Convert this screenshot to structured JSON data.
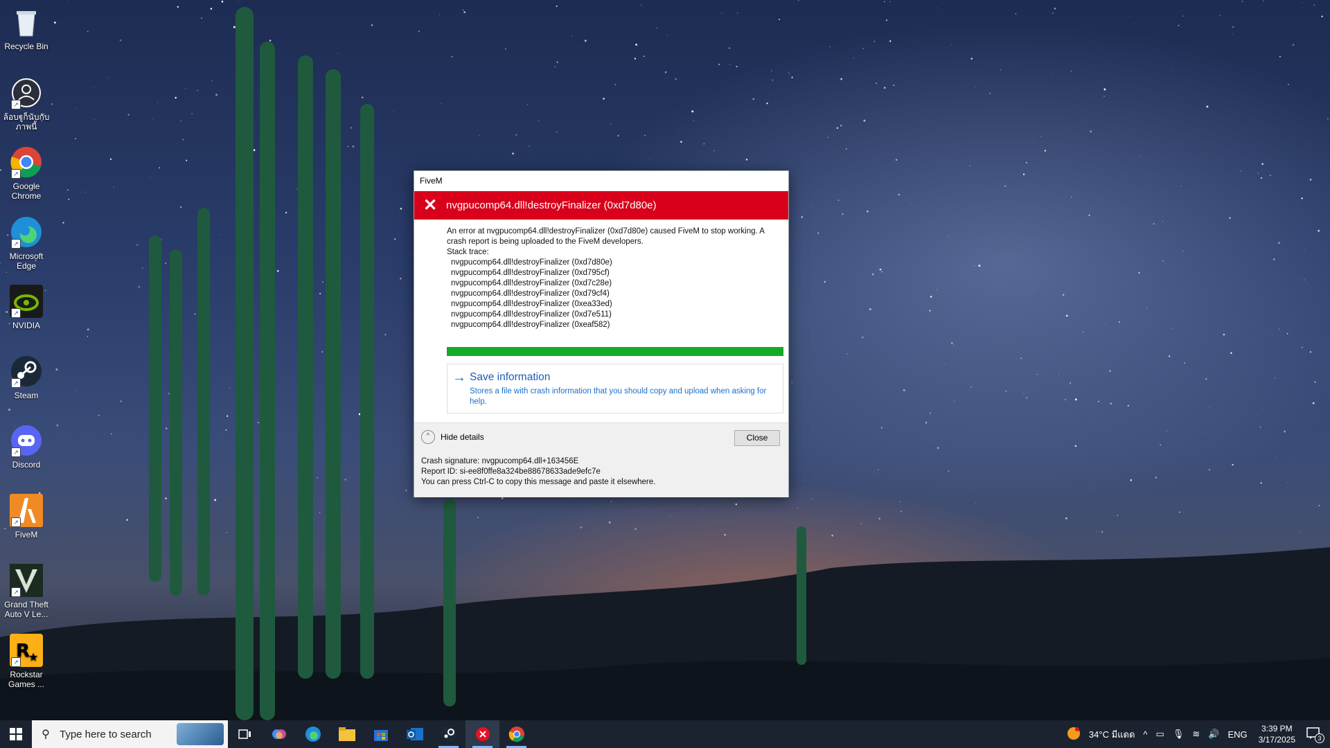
{
  "desktop": {
    "icons": [
      {
        "label": "Recycle Bin",
        "icon": "recycle-bin-icon"
      },
      {
        "label": "ล้อบฐูก็นับกับ ภาพนี้",
        "icon": "user-account-icon"
      },
      {
        "label": "Google Chrome",
        "icon": "chrome-icon"
      },
      {
        "label": "Microsoft Edge",
        "icon": "edge-icon"
      },
      {
        "label": "NVIDIA",
        "icon": "nvidia-icon"
      },
      {
        "label": "Steam",
        "icon": "steam-icon"
      },
      {
        "label": "Discord",
        "icon": "discord-icon"
      },
      {
        "label": "FiveM",
        "icon": "fivem-icon"
      },
      {
        "label": "Grand Theft Auto V Le...",
        "icon": "gta-icon"
      },
      {
        "label": "Rockstar Games ...",
        "icon": "rockstar-icon"
      }
    ]
  },
  "dialog": {
    "window_title": "FiveM",
    "error_title": "nvgpucomp64.dll!destroyFinalizer (0xd7d80e)",
    "message": "An error at nvgpucomp64.dll!destroyFinalizer (0xd7d80e) caused FiveM to stop working. A crash report is being uploaded to the FiveM developers.",
    "stack_label": "Stack trace:",
    "stack": [
      "nvgpucomp64.dll!destroyFinalizer (0xd7d80e)",
      "nvgpucomp64.dll!destroyFinalizer (0xd795cf)",
      "nvgpucomp64.dll!destroyFinalizer (0xd7c28e)",
      "nvgpucomp64.dll!destroyFinalizer (0xd79cf4)",
      "nvgpucomp64.dll!destroyFinalizer (0xea33ed)",
      "nvgpucomp64.dll!destroyFinalizer (0xd7e511)",
      "nvgpucomp64.dll!destroyFinalizer (0xeaf582)"
    ],
    "progress": 1.0,
    "save_title": "Save information",
    "save_desc": "Stores a file with crash information that you should copy and upload when asking for help.",
    "hide_details": "Hide details",
    "close": "Close",
    "crash_signature": "Crash signature: nvgpucomp64.dll+163456E",
    "report_id": "Report ID: si-ee8f0ffe8a324be88678633ade9efc7e",
    "copy_hint": "You can press Ctrl-C to copy this message and paste it elsewhere."
  },
  "taskbar": {
    "search_placeholder": "Type here to search",
    "weather": "34°C มีแดด",
    "language": "ENG",
    "time": "3:39 PM",
    "date": "3/17/2025",
    "notification_count": "3",
    "apps": [
      "task-view-icon",
      "copilot-icon",
      "edge-icon",
      "file-explorer-icon",
      "store-icon",
      "outlook-icon",
      "steam-icon",
      "fivem-error-icon",
      "chrome-icon"
    ]
  },
  "colors": {
    "error_red": "#d9001b",
    "progress_green": "#12ab28",
    "link_blue": "#1a5fb4",
    "taskbar": "#1c2330"
  }
}
